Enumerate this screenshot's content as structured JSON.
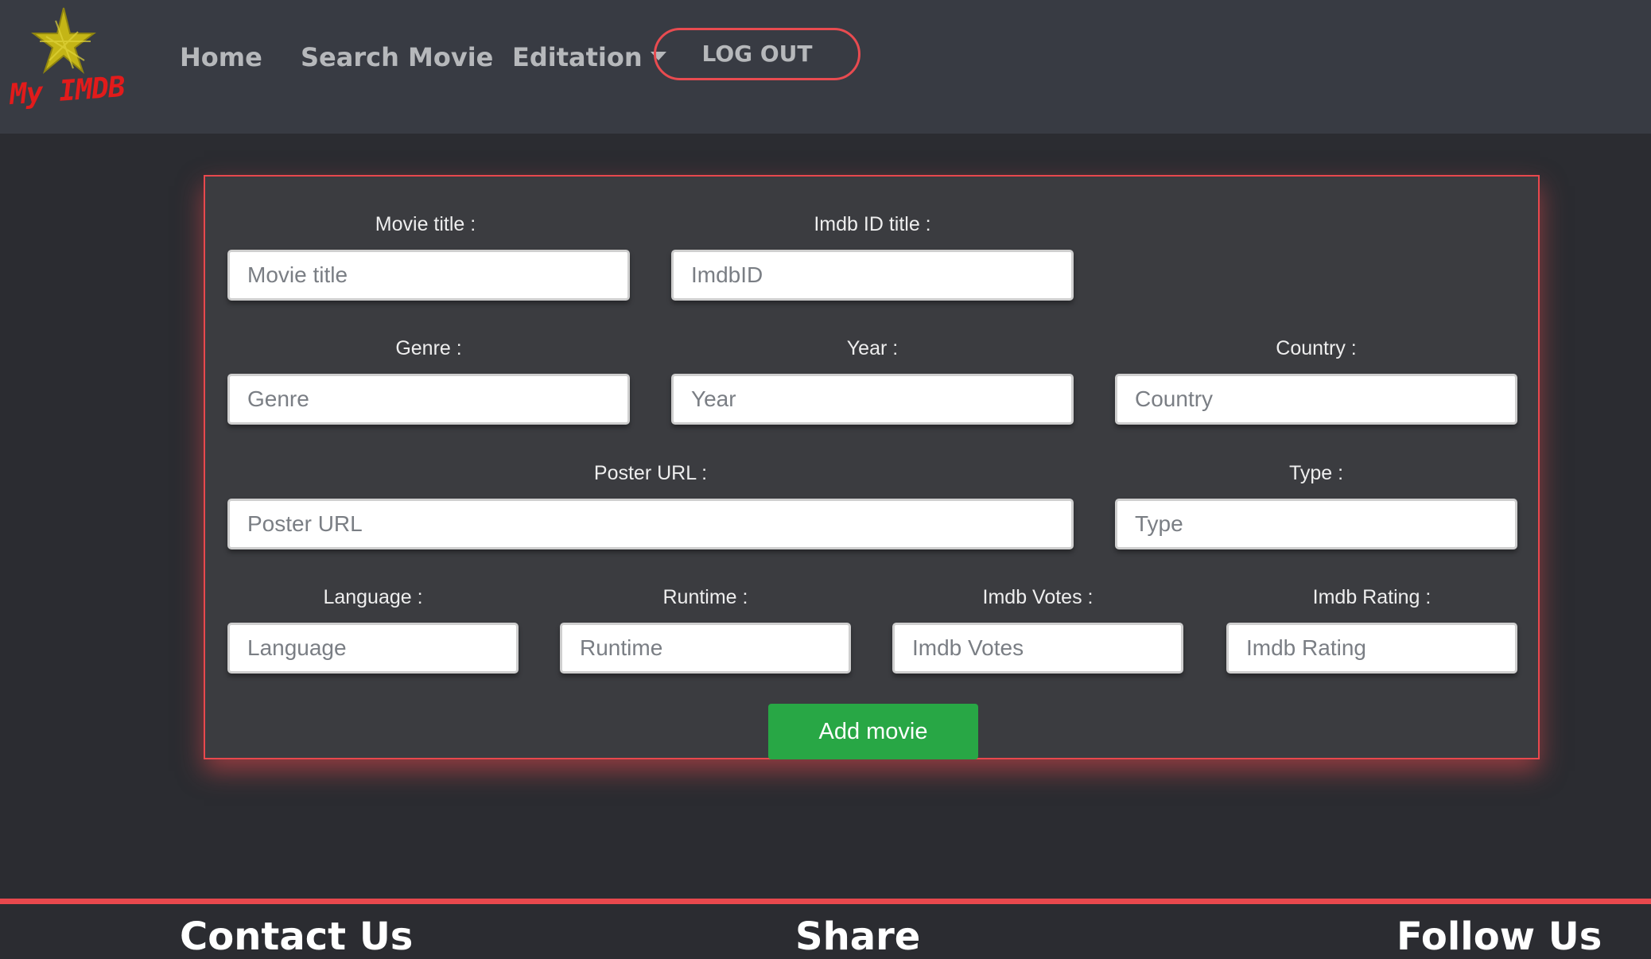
{
  "brand": {
    "logo_text": "My IMDB"
  },
  "nav": {
    "home": "Home",
    "search": "Search Movie",
    "editation": "Editation",
    "logout": "LOG OUT"
  },
  "form": {
    "movie_title": {
      "label": "Movie title :",
      "placeholder": "Movie title"
    },
    "imdb_id": {
      "label": "Imdb ID title :",
      "placeholder": "ImdbID"
    },
    "genre": {
      "label": "Genre :",
      "placeholder": "Genre"
    },
    "year": {
      "label": "Year :",
      "placeholder": "Year"
    },
    "country": {
      "label": "Country :",
      "placeholder": "Country"
    },
    "poster_url": {
      "label": "Poster URL :",
      "placeholder": "Poster URL"
    },
    "type": {
      "label": "Type :",
      "placeholder": "Type"
    },
    "language": {
      "label": "Language :",
      "placeholder": "Language"
    },
    "runtime": {
      "label": "Runtime :",
      "placeholder": "Runtime"
    },
    "imdb_votes": {
      "label": "Imdb Votes :",
      "placeholder": "Imdb Votes"
    },
    "imdb_rating": {
      "label": "Imdb Rating :",
      "placeholder": "Imdb Rating"
    },
    "submit": "Add movie"
  },
  "footer": {
    "col1": "Contact Us",
    "col2": "Share",
    "col3": "Follow Us"
  },
  "colors": {
    "accent": "#e8484d",
    "success": "#28a745",
    "navbar": "#383b43",
    "background": "#2b2c31"
  },
  "icons": {
    "logo": "star-icon",
    "dropdown": "caret-down-icon"
  }
}
